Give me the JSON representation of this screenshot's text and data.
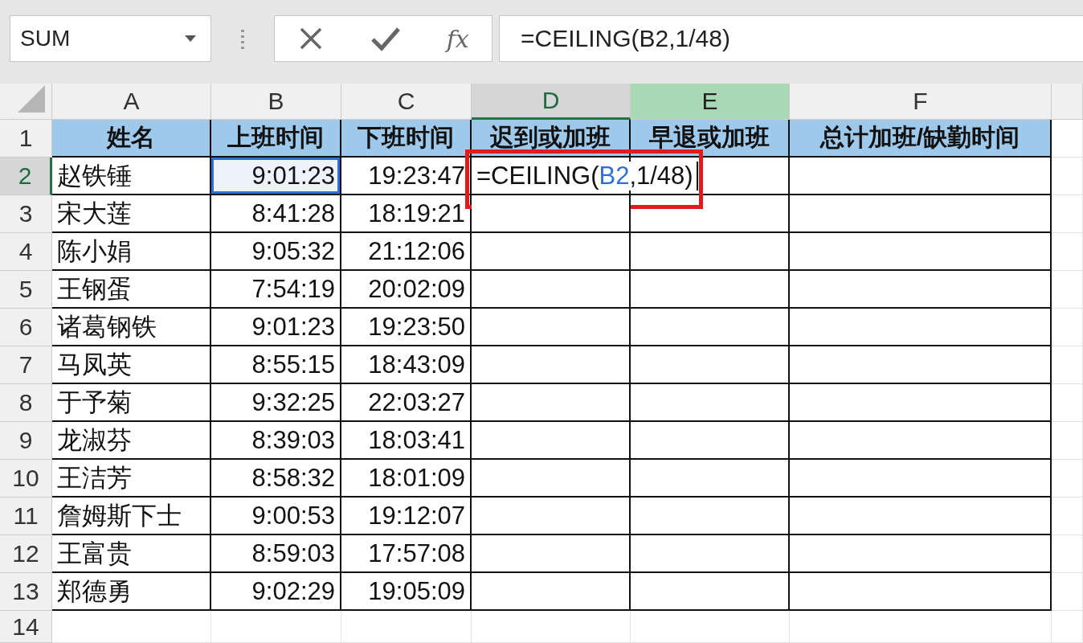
{
  "name_box": {
    "value": "SUM"
  },
  "formula_bar": {
    "function_label": "fx",
    "value": "=CEILING(B2,1/48)"
  },
  "columns": [
    {
      "letter": "A",
      "selected": false,
      "highlighted": false
    },
    {
      "letter": "B",
      "selected": false,
      "highlighted": false
    },
    {
      "letter": "C",
      "selected": false,
      "highlighted": false
    },
    {
      "letter": "D",
      "selected": true,
      "highlighted": false
    },
    {
      "letter": "E",
      "selected": false,
      "highlighted": true
    },
    {
      "letter": "F",
      "selected": false,
      "highlighted": false
    }
  ],
  "header_row": {
    "label": "1",
    "cells": [
      "姓名",
      "上班时间",
      "下班时间",
      "迟到或加班",
      "早退或加班",
      "总计加班/缺勤时间"
    ]
  },
  "rows": [
    {
      "label": "2",
      "selected": true,
      "name": "赵铁锤",
      "start": "9:01:23",
      "end": "19:23:47",
      "start_referenced": true,
      "formula_parts": [
        {
          "text": "=CEILING(",
          "ref": false
        },
        {
          "text": "B2",
          "ref": true
        },
        {
          "text": ",1/48)",
          "ref": false
        }
      ]
    },
    {
      "label": "3",
      "selected": false,
      "name": "宋大莲",
      "start": "8:41:28",
      "end": "18:19:21",
      "start_referenced": false
    },
    {
      "label": "4",
      "selected": false,
      "name": "陈小娟",
      "start": "9:05:32",
      "end": "21:12:06",
      "start_referenced": false
    },
    {
      "label": "5",
      "selected": false,
      "name": "王钢蛋",
      "start": "7:54:19",
      "end": "20:02:09",
      "start_referenced": false
    },
    {
      "label": "6",
      "selected": false,
      "name": "诸葛钢铁",
      "start": "9:01:23",
      "end": "19:23:50",
      "start_referenced": false
    },
    {
      "label": "7",
      "selected": false,
      "name": "马凤英",
      "start": "8:55:15",
      "end": "18:43:09",
      "start_referenced": false
    },
    {
      "label": "8",
      "selected": false,
      "name": "于予菊",
      "start": "9:32:25",
      "end": "22:03:27",
      "start_referenced": false
    },
    {
      "label": "9",
      "selected": false,
      "name": "龙淑芬",
      "start": "8:39:03",
      "end": "18:03:41",
      "start_referenced": false
    },
    {
      "label": "10",
      "selected": false,
      "name": "王洁芳",
      "start": "8:58:32",
      "end": "18:01:09",
      "start_referenced": false
    },
    {
      "label": "11",
      "selected": false,
      "name": "詹姆斯下士",
      "start": "9:00:53",
      "end": "19:12:07",
      "start_referenced": false
    },
    {
      "label": "12",
      "selected": false,
      "name": "王富贵",
      "start": "8:59:03",
      "end": "17:57:08",
      "start_referenced": false
    },
    {
      "label": "13",
      "selected": false,
      "name": "郑德勇",
      "start": "9:02:29",
      "end": "19:05:09",
      "start_referenced": false
    }
  ],
  "empty_rows": [
    "14"
  ]
}
